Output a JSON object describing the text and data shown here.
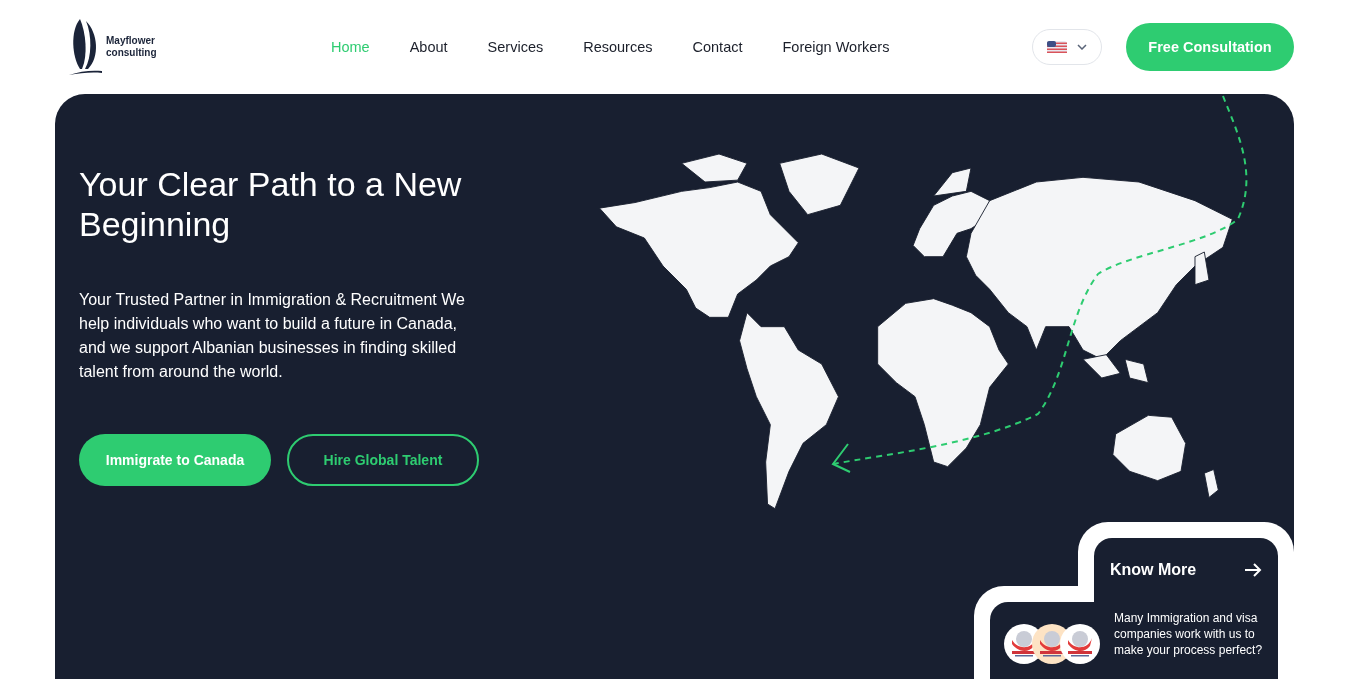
{
  "header": {
    "logo": {
      "line1": "Mayflower",
      "line2": "consulting"
    },
    "nav": [
      {
        "label": "Home",
        "selected": true
      },
      {
        "label": "About",
        "selected": false
      },
      {
        "label": "Services",
        "selected": false
      },
      {
        "label": "Resources",
        "selected": false
      },
      {
        "label": "Contact",
        "selected": false
      },
      {
        "label": "Foreign Workers",
        "selected": false
      }
    ],
    "cta": "Free Consultation"
  },
  "hero": {
    "title": "Your Clear Path to a New Beginning",
    "text": "Your Trusted Partner in Immigration & Recruitment We help individuals who want to build a future in Canada, and we support Albanian businesses in finding skilled talent from around the world.",
    "buttons": [
      {
        "label": "Immigrate to Canada",
        "kind": "primary"
      },
      {
        "label": "Hire Global Talent",
        "kind": "outline"
      }
    ]
  },
  "know_more": {
    "label": "Know More",
    "text": "Many Immigration and visa companies work with us to make your process perfect?"
  }
}
